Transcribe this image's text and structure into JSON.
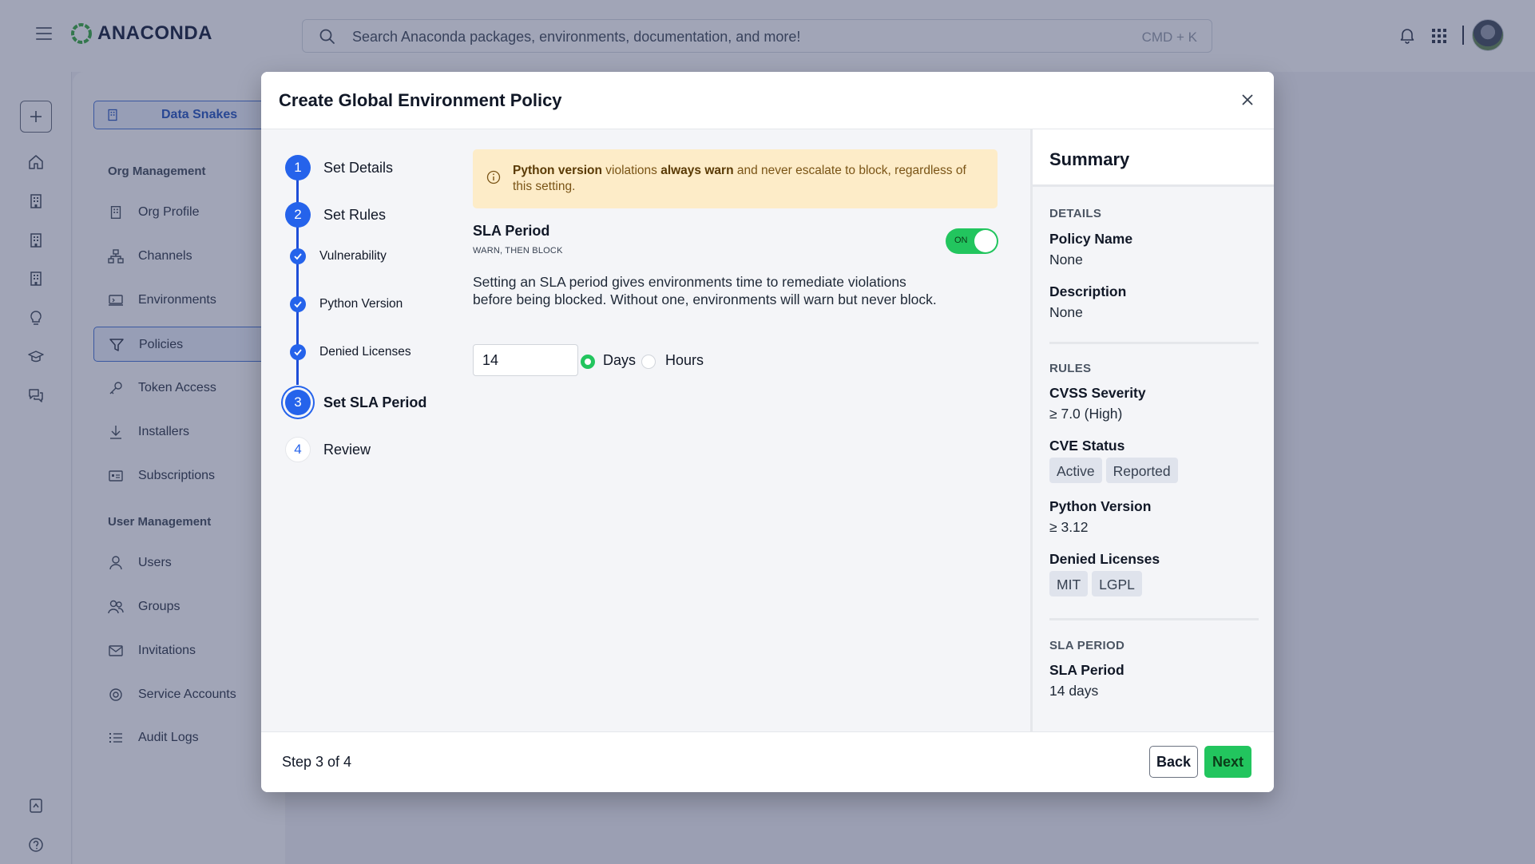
{
  "topbar": {
    "logo_text": "ANACONDA",
    "search_placeholder": "Search Anaconda packages, environments, documentation, and more!",
    "search_shortcut": "CMD + K"
  },
  "sidebar": {
    "org_name": "Data Snakes",
    "org_section": "Org Management",
    "user_section": "User Management",
    "org_items": [
      {
        "label": "Org Profile",
        "icon": "building-icon"
      },
      {
        "label": "Channels",
        "icon": "channels-icon"
      },
      {
        "label": "Environments",
        "icon": "environments-icon"
      },
      {
        "label": "Policies",
        "icon": "filter-icon",
        "active": true
      },
      {
        "label": "Token Access",
        "icon": "key-icon"
      },
      {
        "label": "Installers",
        "icon": "download-icon"
      },
      {
        "label": "Subscriptions",
        "icon": "card-icon"
      }
    ],
    "user_items": [
      {
        "label": "Users",
        "icon": "user-icon"
      },
      {
        "label": "Groups",
        "icon": "group-icon"
      },
      {
        "label": "Invitations",
        "icon": "mail-icon"
      },
      {
        "label": "Service Accounts",
        "icon": "service-icon"
      },
      {
        "label": "Audit Logs",
        "icon": "list-icon"
      }
    ]
  },
  "modal": {
    "title": "Create Global Environment Policy",
    "steps": [
      {
        "number": "1",
        "label": "Set Details"
      },
      {
        "number": "2",
        "label": "Set Rules"
      },
      {
        "number": "3",
        "label": "Set SLA Period"
      },
      {
        "number": "4",
        "label": "Review"
      }
    ],
    "substeps": [
      "Vulnerability",
      "Python Version",
      "Denied Licenses"
    ],
    "alert": {
      "b1": "Python version",
      "t1": " violations ",
      "b2": "always warn",
      "t2": " and never escalate to block, regardless of this setting."
    },
    "sla": {
      "title": "SLA Period",
      "subtitle": "WARN, THEN BLOCK",
      "toggle_label": "ON",
      "toggle_on": true,
      "description": "Setting an SLA period gives environments time to remediate violations before being blocked. Without one, environments will warn but never block.",
      "value": "14",
      "unit_options": [
        "Days",
        "Hours"
      ],
      "selected_unit": "Days"
    },
    "summary": {
      "title": "Summary",
      "details_heading": "DETAILS",
      "policy_name_label": "Policy Name",
      "policy_name_value": "None",
      "description_label": "Description",
      "description_value": "None",
      "rules_heading": "RULES",
      "cvss_label": "CVSS Severity",
      "cvss_value": "≥ 7.0 (High)",
      "cve_label": "CVE Status",
      "cve_chips": [
        "Active",
        "Reported"
      ],
      "python_label": "Python Version",
      "python_value": "≥ 3.12",
      "licenses_label": "Denied Licenses",
      "license_chips": [
        "MIT",
        "LGPL"
      ],
      "sla_heading": "SLA PERIOD",
      "sla_label": "SLA Period",
      "sla_value": "14 days"
    },
    "footer": {
      "step_text": "Step 3 of 4",
      "back_label": "Back",
      "next_label": "Next"
    }
  },
  "colors": {
    "accent_blue": "#2563eb",
    "success_green": "#22c55e",
    "alert_bg": "#fdecc8"
  }
}
